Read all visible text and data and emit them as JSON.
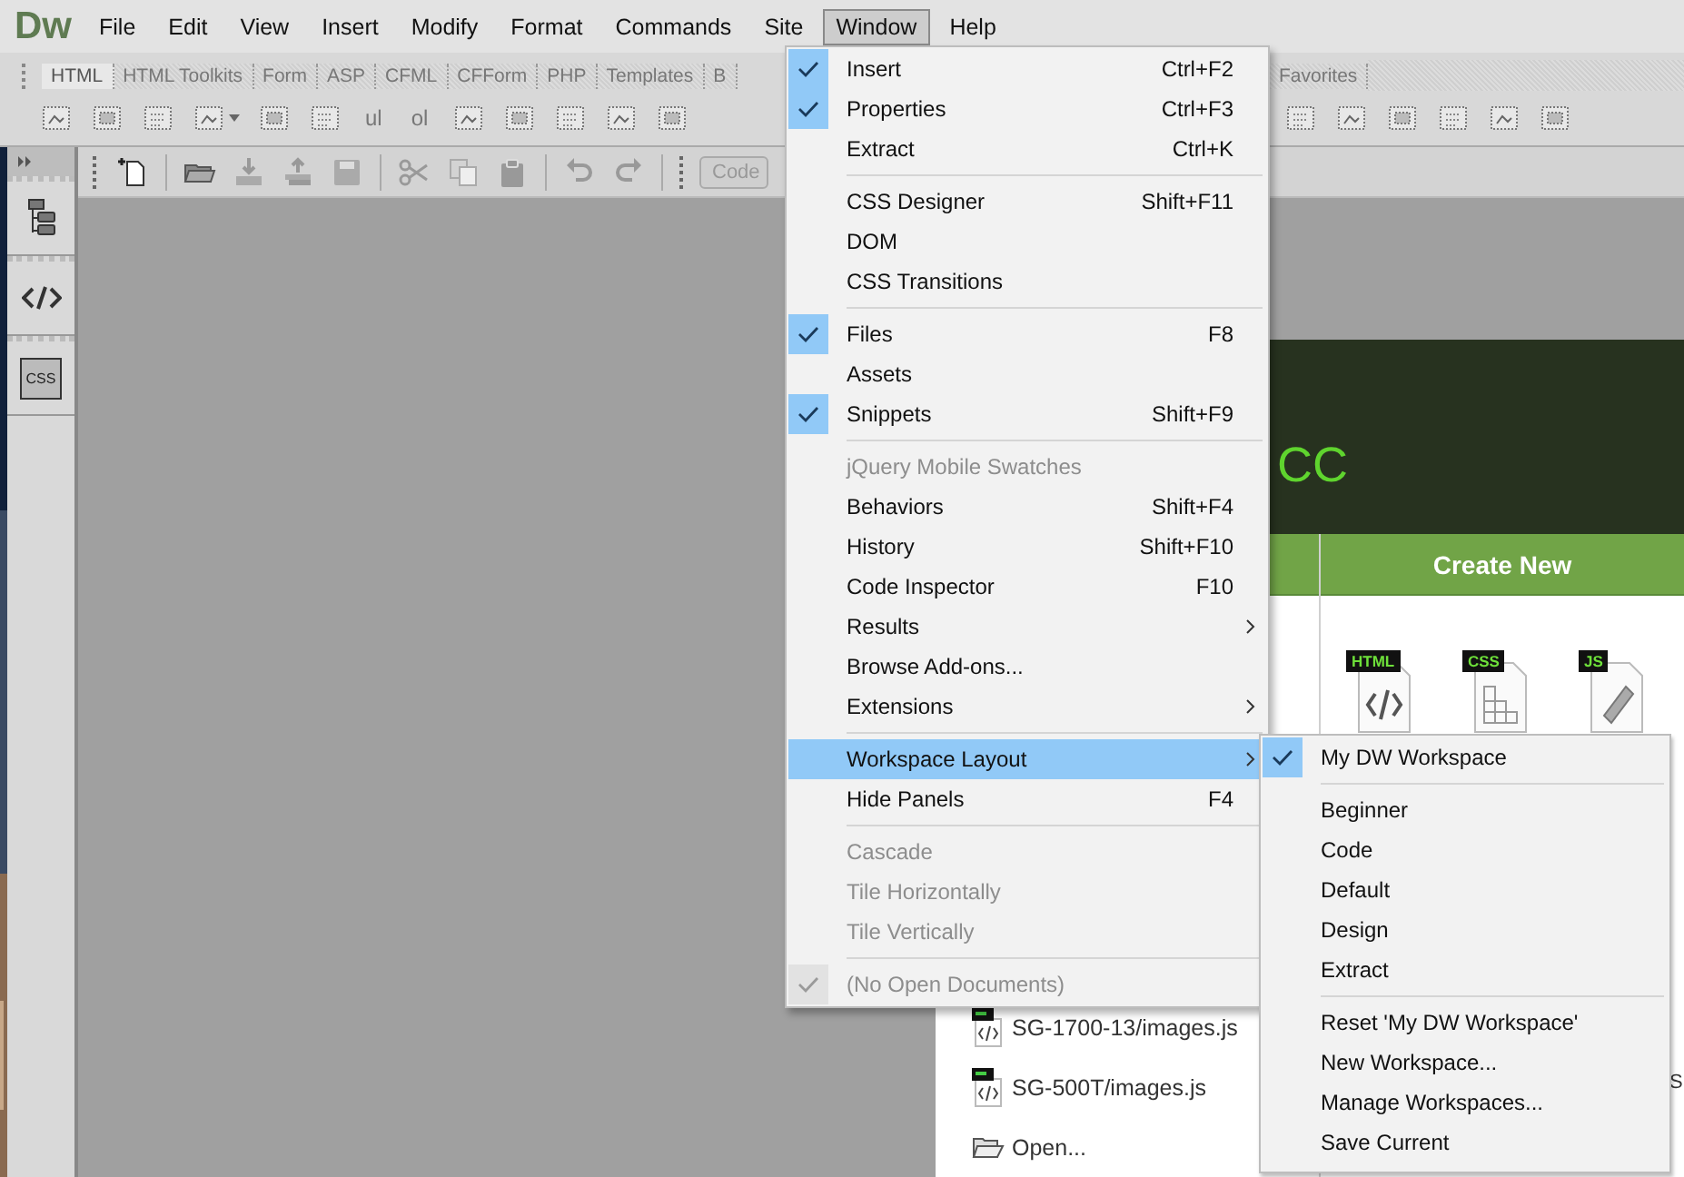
{
  "app": {
    "logo": "Dw"
  },
  "menubar": [
    {
      "label": "File",
      "selected": false
    },
    {
      "label": "Edit",
      "selected": false
    },
    {
      "label": "View",
      "selected": false
    },
    {
      "label": "Insert",
      "selected": false
    },
    {
      "label": "Modify",
      "selected": false
    },
    {
      "label": "Format",
      "selected": false
    },
    {
      "label": "Commands",
      "selected": false
    },
    {
      "label": "Site",
      "selected": false
    },
    {
      "label": "Window",
      "selected": true
    },
    {
      "label": "Help",
      "selected": false
    }
  ],
  "insert_toolbar": {
    "tabs": [
      {
        "label": "HTML",
        "selected": true
      },
      {
        "label": "HTML Toolkits",
        "selected": false
      },
      {
        "label": "Form",
        "selected": false
      },
      {
        "label": "ASP",
        "selected": false
      },
      {
        "label": "CFML",
        "selected": false
      },
      {
        "label": "CFForm",
        "selected": false
      },
      {
        "label": "PHP",
        "selected": false
      },
      {
        "label": "Templates",
        "selected": false
      },
      {
        "label": "B",
        "selected": false
      },
      {
        "label": "Favorites",
        "selected": false
      }
    ],
    "text_buttons": [
      "ul",
      "ol"
    ]
  },
  "standard_toolbar": {
    "view_button": "Code"
  },
  "left_panel": {
    "css_label": "CSS"
  },
  "window_menu": {
    "items": [
      {
        "kind": "item",
        "label": "Insert",
        "shortcut": "Ctrl+F2",
        "checked": true,
        "disabled": false,
        "submenu": false,
        "selected": false
      },
      {
        "kind": "item",
        "label": "Properties",
        "shortcut": "Ctrl+F3",
        "checked": true,
        "disabled": false,
        "submenu": false,
        "selected": false
      },
      {
        "kind": "item",
        "label": "Extract",
        "shortcut": "Ctrl+K",
        "checked": false,
        "disabled": false,
        "submenu": false,
        "selected": false
      },
      {
        "kind": "separator"
      },
      {
        "kind": "item",
        "label": "CSS Designer",
        "shortcut": "Shift+F11",
        "checked": false,
        "disabled": false,
        "submenu": false,
        "selected": false
      },
      {
        "kind": "item",
        "label": "DOM",
        "checked": false,
        "disabled": false,
        "submenu": false,
        "selected": false
      },
      {
        "kind": "item",
        "label": "CSS Transitions",
        "checked": false,
        "disabled": false,
        "submenu": false,
        "selected": false
      },
      {
        "kind": "separator"
      },
      {
        "kind": "item",
        "label": "Files",
        "shortcut": "F8",
        "checked": true,
        "disabled": false,
        "submenu": false,
        "selected": false
      },
      {
        "kind": "item",
        "label": "Assets",
        "checked": false,
        "disabled": false,
        "submenu": false,
        "selected": false
      },
      {
        "kind": "item",
        "label": "Snippets",
        "shortcut": "Shift+F9",
        "checked": true,
        "disabled": false,
        "submenu": false,
        "selected": false
      },
      {
        "kind": "separator"
      },
      {
        "kind": "item",
        "label": "jQuery Mobile Swatches",
        "checked": false,
        "disabled": true,
        "submenu": false,
        "selected": false
      },
      {
        "kind": "item",
        "label": "Behaviors",
        "shortcut": "Shift+F4",
        "checked": false,
        "disabled": false,
        "submenu": false,
        "selected": false
      },
      {
        "kind": "item",
        "label": "History",
        "shortcut": "Shift+F10",
        "checked": false,
        "disabled": false,
        "submenu": false,
        "selected": false
      },
      {
        "kind": "item",
        "label": "Code Inspector",
        "shortcut": "F10",
        "checked": false,
        "disabled": false,
        "submenu": false,
        "selected": false
      },
      {
        "kind": "item",
        "label": "Results",
        "checked": false,
        "disabled": false,
        "submenu": true,
        "selected": false
      },
      {
        "kind": "item",
        "label": "Browse Add-ons...",
        "checked": false,
        "disabled": false,
        "submenu": false,
        "selected": false
      },
      {
        "kind": "item",
        "label": "Extensions",
        "checked": false,
        "disabled": false,
        "submenu": true,
        "selected": false
      },
      {
        "kind": "separator"
      },
      {
        "kind": "item",
        "label": "Workspace Layout",
        "checked": false,
        "disabled": false,
        "submenu": true,
        "selected": true
      },
      {
        "kind": "item",
        "label": "Hide Panels",
        "shortcut": "F4",
        "checked": false,
        "disabled": false,
        "submenu": false,
        "selected": false
      },
      {
        "kind": "separator"
      },
      {
        "kind": "item",
        "label": "Cascade",
        "checked": false,
        "disabled": true,
        "submenu": false,
        "selected": false
      },
      {
        "kind": "item",
        "label": "Tile Horizontally",
        "checked": false,
        "disabled": true,
        "submenu": false,
        "selected": false
      },
      {
        "kind": "item",
        "label": "Tile Vertically",
        "checked": false,
        "disabled": true,
        "submenu": false,
        "selected": false
      },
      {
        "kind": "separator"
      },
      {
        "kind": "item",
        "label": "(No Open Documents)",
        "checked": true,
        "disabled": true,
        "submenu": false,
        "selected": false
      }
    ]
  },
  "workspace_submenu": {
    "items": [
      {
        "kind": "item",
        "label": "My DW Workspace",
        "checked": true
      },
      {
        "kind": "separator"
      },
      {
        "kind": "item",
        "label": "Beginner",
        "checked": false
      },
      {
        "kind": "item",
        "label": "Code",
        "checked": false
      },
      {
        "kind": "item",
        "label": "Default",
        "checked": false
      },
      {
        "kind": "item",
        "label": "Design",
        "checked": false
      },
      {
        "kind": "item",
        "label": "Extract",
        "checked": false
      },
      {
        "kind": "separator"
      },
      {
        "kind": "item",
        "label": "Reset 'My DW Workspace'",
        "checked": false
      },
      {
        "kind": "item",
        "label": "New Workspace...",
        "checked": false
      },
      {
        "kind": "item",
        "label": "Manage Workspaces...",
        "checked": false
      },
      {
        "kind": "item",
        "label": "Save Current",
        "checked": false
      }
    ]
  },
  "welcome": {
    "title": "CC",
    "create_new_header": "Create New",
    "create_new": [
      {
        "label": "HTML",
        "kind": "html"
      },
      {
        "label": "CSS",
        "kind": "css"
      },
      {
        "label": "JS",
        "kind": "js"
      }
    ],
    "recent_files": [
      "SG-1700-13/images.js",
      "SG-500T/images.js"
    ],
    "open_item": "Open...",
    "column_3_text": "S"
  }
}
